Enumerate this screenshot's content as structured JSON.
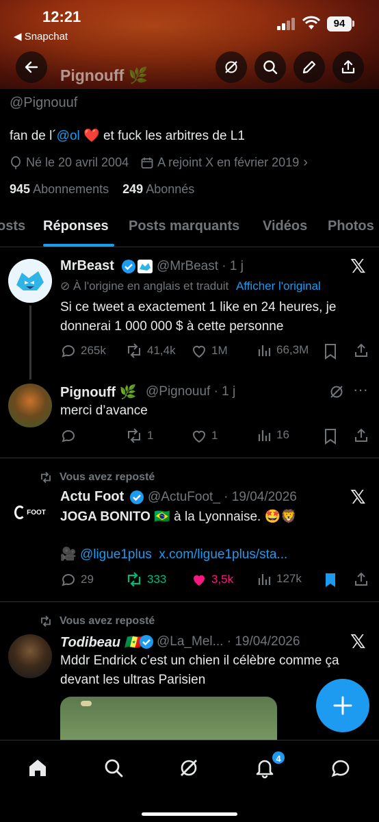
{
  "status_bar": {
    "time": "12:21",
    "back_app": "◀ Snapchat",
    "battery": "94"
  },
  "header": {
    "title": "Pignouff 🌿"
  },
  "profile": {
    "handle": "@Pignouuf",
    "bio_prefix": "fan de l´",
    "bio_mention": "@ol",
    "bio_suffix": " ❤️  et fuck les arbitres de L1",
    "birth": "Né le 20 avril 2004",
    "joined": "A rejoint X en février 2019",
    "following_count": "945",
    "following_label": "Abonnements",
    "followers_count": "249",
    "followers_label": "Abonnés"
  },
  "tabs": [
    "osts",
    "Réponses",
    "Posts marquants",
    "Vidéos",
    "Photos"
  ],
  "posts": [
    {
      "name": "MrBeast",
      "handle": "@MrBeast · 1 j",
      "translated": "À l'origine en anglais et traduit",
      "show_original": "Afficher l'original",
      "text": "Si ce tweet a exactement 1 like en 24 heures, je donnerai 1 000 000 $ à cette personne",
      "replies": "265k",
      "reposts": "41,4k",
      "likes": "1M",
      "views": "66,3M"
    },
    {
      "name": "Pignouff 🌿",
      "handle": "@Pignouuf · 1 j",
      "text": "merci d’avance",
      "replies": "",
      "reposts": "1",
      "likes": "1",
      "views": "16"
    },
    {
      "repost_label": "Vous avez reposté",
      "name": "Actu Foot",
      "handle": "@ActuFoot_ · 19/04/2026",
      "avatar_text": "FOOT",
      "text_bold": "JOGA BONITO 🇧🇷",
      "text": " à la Lyonnaise. 🤩🦁",
      "link_line": "🎥 ",
      "link_mention": "@ligue1plus",
      "link_url": "x.com/ligue1plus/sta...",
      "replies": "29",
      "reposts": "333",
      "likes": "3,5k",
      "views": "127k"
    },
    {
      "repost_label": "Vous avez reposté",
      "name": "Todibeau 🇸🇳",
      "handle": "@La_Mel... · 19/04/2026",
      "text": "Mddr Endrick c’est un chien il célèbre comme ça devant les ultras Parisien"
    }
  ],
  "notifications_badge": "4",
  "colors": {
    "accent": "#1d9bf0",
    "like": "#f91880",
    "repost": "#00ba7c",
    "muted": "#71767b",
    "bg": "#000000"
  }
}
